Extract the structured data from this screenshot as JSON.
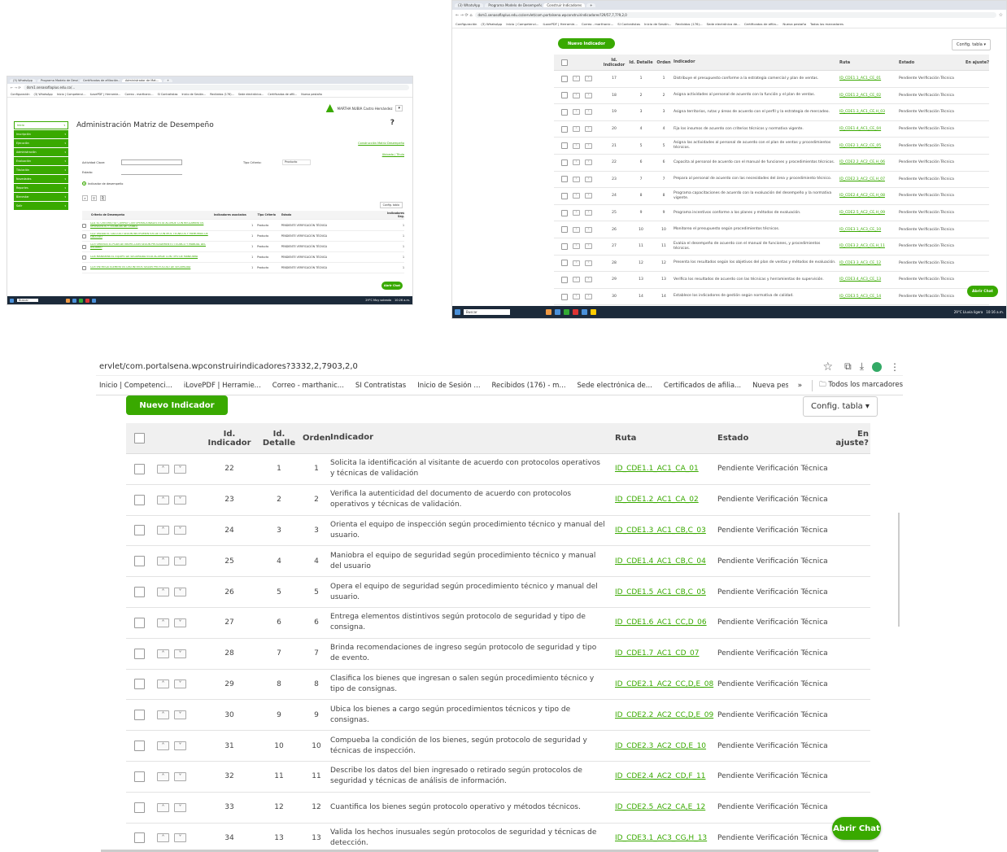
{
  "panel_a": {
    "tabs": [
      "(3) WhatsApp",
      "Programa Modelo de Desempeño...",
      "Certificados de afiliación...",
      "Administrador de Mat...",
      "+"
    ],
    "url": "dsm1.senasofiaplus.edu.co/...",
    "bookmarks": [
      "Configuración",
      "(3) WhatsApp",
      "Inicio | Competenci...",
      "iLovePDF | Herramie...",
      "Correo - marthanic...",
      "SI Contratistas",
      "Inicio de Sesión...",
      "Recibidos (176)...",
      "Sede electrónica...",
      "Certificados de afili...",
      "Nueva pestaña"
    ],
    "user": "MARTHA NUBIA Castro Hernández",
    "page_title": "Administración Matriz de Desempeño",
    "sidebar": [
      "Inicio",
      "Inscripción",
      "Ejecución",
      "Administración",
      "Evaluación",
      "Titulación",
      "Novedades",
      "Reportes",
      "Bienestar",
      "Salir"
    ],
    "side_link": "Construcción Matriz Desempeño",
    "form": {
      "actividad_clave": "Actividad Clave:",
      "estado": "Estado:",
      "tipo_criterio": "Tipo Criterio:",
      "tipo_value": "Producto",
      "add": "Indicador de desempeño",
      "right_link": "Ubicado / Titulo"
    },
    "config": "Config. tabla",
    "headers": [
      "Criterio de Desempeño",
      "Indicadores asociados",
      "Tipo Criterio",
      "Estado",
      "Indicadores Seg."
    ],
    "rows": [
      {
        "crit": "CD1 EL CRITERIO SE CUMPLE CON OPERACIONALES ESTÁ ACORDE CON REGLAMENTOS OPERATIVOS Y TÉCNICAS DE CRIBEO",
        "n": "1",
        "tipo": "Producto",
        "estado": "PENDIENTE VERIFICACIÓN TÉCNICA",
        "seg": "1"
      },
      {
        "crit": "CD2 VALIDA EL CÁLCULO SEGÚN INSTRUMENTOS DE CONTROL TÉCNICOS Y MEMORIAS DE CÁLCULO",
        "n": "1",
        "tipo": "Producto",
        "estado": "PENDIENTE VERIFICACIÓN TÉCNICA",
        "seg": "1"
      },
      {
        "crit": "CD3 ORIENTA EL PLAN DE INSPECCIÓN SEGÚN PROCEDIMIENTO TÉCNICO Y MANUAL DEL USUARIO",
        "n": "1",
        "tipo": "Producto",
        "estado": "PENDIENTE VERIFICACIÓN TÉCNICA",
        "seg": "1"
      },
      {
        "crit": "CD4 MANIOBRA EL EQUIPO DE SEGURIDAD ESTÁ ACORDE CON TIPO DE MANIOBRA",
        "n": "1",
        "tipo": "Producto",
        "estado": "PENDIENTE VERIFICACIÓN TÉCNICA",
        "seg": "1"
      },
      {
        "crit": "CD5 ENTREGA ELEMENTOS DISTINTIVOS SEGÚN PROTOCOLO DE SEGURIDAD",
        "n": "1",
        "tipo": "Producto",
        "estado": "PENDIENTE VERIFICACIÓN TÉCNICA",
        "seg": "1"
      }
    ],
    "chat": "Abrir Chat",
    "task_search": "Buscar",
    "weather": "29°C Muy soleado",
    "clock": "10:26 a.m."
  },
  "panel_b": {
    "tabs": [
      "(3) WhatsApp",
      "Programa Modelo de Desempeño",
      "Construir Indicadores",
      "+"
    ],
    "url": "dsm1.senasofiaplus.edu.co/servlet/com.portalsena.wpconstruirindicadores?29/57,7,7?9,2,0",
    "bookmarks": [
      "Configuración",
      "(3) WhatsApp",
      "Inicio | Competenci...",
      "iLovePDF | Herramie...",
      "Correo - marthanic...",
      "SI Contratistas",
      "Inicio de Sesión...",
      "Recibidos (176)...",
      "Sede electrónica de...",
      "Certificados de afilia...",
      "Nueva pestaña",
      "Todos los marcadores"
    ],
    "nuevo": "Nuevo Indicador",
    "config": "Config. tabla ▾",
    "headers": [
      "Id. Indicador",
      "Id. Detalle",
      "Orden",
      "Indicador",
      "Ruta",
      "Estado",
      "En ajuste?"
    ],
    "rows": [
      {
        "id": "17",
        "det": "1",
        "ord": "1",
        "ind": "Distribuye el presupuesto conforme a la estrategia comercial y plan de ventas.",
        "ruta": "ID_CDE1.1_AC1_CE_01",
        "est": "Pendiente Verificación Técnica"
      },
      {
        "id": "18",
        "det": "2",
        "ord": "2",
        "ind": "Asigna actividades al personal de acuerdo con la función y el plan de ventas.",
        "ruta": "ID_CDE1.2_AC1_CE_02",
        "est": "Pendiente Verificación Técnica"
      },
      {
        "id": "19",
        "det": "3",
        "ord": "3",
        "ind": "Asigna territorios, rutas y áreas de acuerdo con el perfil y la estrategia de mercadeo.",
        "ruta": "ID_CDE1.3_AC1_CE,H_03",
        "est": "Pendiente Verificación Técnica"
      },
      {
        "id": "20",
        "det": "4",
        "ord": "4",
        "ind": "Fija los insumos de acuerdo con criterios técnicos y normativa vigente.",
        "ruta": "ID_CDE1.4_AC1_CE_04",
        "est": "Pendiente Verificación Técnica"
      },
      {
        "id": "21",
        "det": "5",
        "ord": "5",
        "ind": "Asigna las actividades al personal de acuerdo con el plan de ventas y procedimientos técnicos.",
        "ruta": "ID_CDE2.1_AC2_CE_05",
        "est": "Pendiente Verificación Técnica"
      },
      {
        "id": "22",
        "det": "6",
        "ord": "6",
        "ind": "Capacita al personal de acuerdo con el manual de funciones y procedimientos técnicos.",
        "ruta": "ID_CDE2.2_AC2_CE,H_06",
        "est": "Pendiente Verificación Técnica"
      },
      {
        "id": "23",
        "det": "7",
        "ord": "7",
        "ind": "Prepara al personal de acuerdo con las necesidades del área y procedimiento técnico.",
        "ruta": "ID_CDE2.3_AC2_CE,H_07",
        "est": "Pendiente Verificación Técnica"
      },
      {
        "id": "24",
        "det": "8",
        "ord": "8",
        "ind": "Programa capacitaciones de acuerdo con la evaluación del desempeño y la normativa vigente.",
        "ruta": "ID_CDE2.4_AC2_CE,H_08",
        "est": "Pendiente Verificación Técnica"
      },
      {
        "id": "25",
        "det": "9",
        "ord": "9",
        "ind": "Programa incentivos conforme a los planes y métodos de evaluación.",
        "ruta": "ID_CDE2.5_AC2_CE,H_09",
        "est": "Pendiente Verificación Técnica"
      },
      {
        "id": "26",
        "det": "10",
        "ord": "10",
        "ind": "Monitorea el presupuesto según procedimientos técnicos.",
        "ruta": "ID_CDE3.1_AC3_CE_10",
        "est": "Pendiente Verificación Técnica"
      },
      {
        "id": "27",
        "det": "11",
        "ord": "11",
        "ind": "Evalúa el desempeño de acuerdo con el manual de funciones, y procedimientos técnicos.",
        "ruta": "ID_CDE3.2_AC3_CE,H_11",
        "est": "Pendiente Verificación Técnica"
      },
      {
        "id": "28",
        "det": "12",
        "ord": "12",
        "ind": "Presenta los resultados según los objetivos del plan de ventas y métodos de evaluación.",
        "ruta": "ID_CDE3.3_AC3_CE_12",
        "est": "Pendiente Verificación Técnica"
      },
      {
        "id": "29",
        "det": "13",
        "ord": "13",
        "ind": "Verifica los resultados de acuerdo con las técnicas y herramientas de supervisión.",
        "ruta": "ID_CDE3.4_AC3_CE_13",
        "est": "Pendiente Verificación Técnica"
      },
      {
        "id": "30",
        "det": "14",
        "ord": "14",
        "ind": "Establece los indicadores de gestión según normativa de calidad.",
        "ruta": "ID_CDE3.5_AC3_CE_14",
        "est": "Pendiente Verificación Técnica"
      }
    ],
    "chat": "Abrir Chat",
    "task_search": "Buscar",
    "weather": "29°C Lluvia ligera",
    "clock": "10:16 a.m."
  },
  "panel_c": {
    "url": "ervlet/com.portalsena.wpconstruirindicadores?3332,2,7903,2,0",
    "bookmarks": [
      "Inicio | Competenci...",
      "iLovePDF | Herramie...",
      "Correo - marthanic...",
      "SI Contratistas",
      "Inicio de Sesión ...",
      "Recibidos (176) - m...",
      "Sede electrónica de...",
      "Certificados de afilia...",
      "Nueva pestaña"
    ],
    "all_bookmarks": "Todos los marcadores",
    "nuevo": "Nuevo Indicador",
    "config": "Config. tabla ▾",
    "headers": [
      "Id. Indicador",
      "Id. Detalle",
      "Orden",
      "Indicador",
      "Ruta",
      "Estado",
      "En ajuste?"
    ],
    "rows": [
      {
        "id": "22",
        "det": "1",
        "ord": "1",
        "ind": "Solicita la identificación al visitante de acuerdo con protocolos operativos y técnicas de validación",
        "ruta": "ID_CDE1.1_AC1_CA_01",
        "est": "Pendiente Verificación Técnica"
      },
      {
        "id": "23",
        "det": "2",
        "ord": "2",
        "ind": "Verifica la autenticidad del documento de acuerdo con protocolos operativos y técnicas de validación.",
        "ruta": "ID_CDE1.2_AC1_CA_02",
        "est": "Pendiente Verificación Técnica"
      },
      {
        "id": "24",
        "det": "3",
        "ord": "3",
        "ind": "Orienta el equipo de inspección según procedimiento técnico y manual del usuario.",
        "ruta": "ID_CDE1.3_AC1_CB,C_03",
        "est": "Pendiente Verificación Técnica"
      },
      {
        "id": "25",
        "det": "4",
        "ord": "4",
        "ind": "Maniobra el equipo de seguridad según procedimiento técnico y manual del usuario",
        "ruta": "ID_CDE1.4_AC1_CB,C_04",
        "est": "Pendiente Verificación Técnica"
      },
      {
        "id": "26",
        "det": "5",
        "ord": "5",
        "ind": "Opera el equipo de seguridad según procedimiento técnico y manual del usuario.",
        "ruta": "ID_CDE1.5_AC1_CB,C_05",
        "est": "Pendiente Verificación Técnica"
      },
      {
        "id": "27",
        "det": "6",
        "ord": "6",
        "ind": "Entrega elementos distintivos según protocolo de seguridad y tipo de consigna.",
        "ruta": "ID_CDE1.6_AC1_CC,D_06",
        "est": "Pendiente Verificación Técnica"
      },
      {
        "id": "28",
        "det": "7",
        "ord": "7",
        "ind": "Brinda recomendaciones de ingreso según protocolo de seguridad y tipo de evento.",
        "ruta": "ID_CDE1.7_AC1_CD_07",
        "est": "Pendiente Verificación Técnica"
      },
      {
        "id": "29",
        "det": "8",
        "ord": "8",
        "ind": "Clasifica los bienes que ingresan o salen según procedimiento técnico y tipo de consignas.",
        "ruta": "ID_CDE2.1_AC2_CC,D,E_08",
        "est": "Pendiente Verificación Técnica"
      },
      {
        "id": "30",
        "det": "9",
        "ord": "9",
        "ind": "Ubica los bienes a cargo según procedimientos técnicos y tipo de consignas.",
        "ruta": "ID_CDE2.2_AC2_CC,D,E_09",
        "est": "Pendiente Verificación Técnica"
      },
      {
        "id": "31",
        "det": "10",
        "ord": "10",
        "ind": "Compueba la condición de los bienes, según protocolo de seguridad y técnicas de inspección.",
        "ruta": "ID_CDE2.3_AC2_CD,E_10",
        "est": "Pendiente Verificación Técnica"
      },
      {
        "id": "32",
        "det": "11",
        "ord": "11",
        "ind": "Describe los datos del bien ingresado o retirado según protocolos de seguridad y técnicas de análisis de información.",
        "ruta": "ID_CDE2.4_AC2_CD,F_11",
        "est": "Pendiente Verificación Técnica"
      },
      {
        "id": "33",
        "det": "12",
        "ord": "12",
        "ind": "Cuantifica los bienes según protocolo operativo y métodos técnicos.",
        "ruta": "ID_CDE2.5_AC2_CA,E_12",
        "est": "Pendiente Verificación Técnica"
      },
      {
        "id": "34",
        "det": "13",
        "ord": "13",
        "ind": "Valida los hechos inusuales según protocolos de seguridad y técnicas de detección.",
        "ruta": "ID_CDE3.1_AC3_CG,H_13",
        "est": "Pendiente Verificación Técnica"
      }
    ],
    "chat": "Abrir Chat"
  },
  "colors": {
    "accent": "#39a900",
    "taskbar": "#1c2a3a"
  }
}
